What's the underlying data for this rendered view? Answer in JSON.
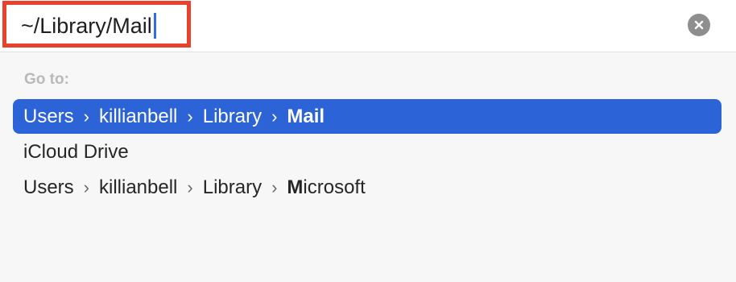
{
  "search": {
    "value": "~/Library/Mail"
  },
  "goto_label": "Go to:",
  "results": [
    {
      "segments": [
        "Users",
        "killianbell",
        "Library"
      ],
      "last_bold": "Mail",
      "last_rest": "",
      "selected": true
    },
    {
      "label": "iCloud Drive",
      "selected": false
    },
    {
      "segments": [
        "Users",
        "killianbell",
        "Library"
      ],
      "last_bold": "M",
      "last_rest": "icrosoft",
      "selected": false
    }
  ],
  "icons": {
    "separator": "chevron-right-icon",
    "clear": "clear-icon"
  },
  "colors": {
    "selection": "#2c63d6",
    "highlight_border": "#e8412c",
    "caret": "#2f6ee0"
  }
}
